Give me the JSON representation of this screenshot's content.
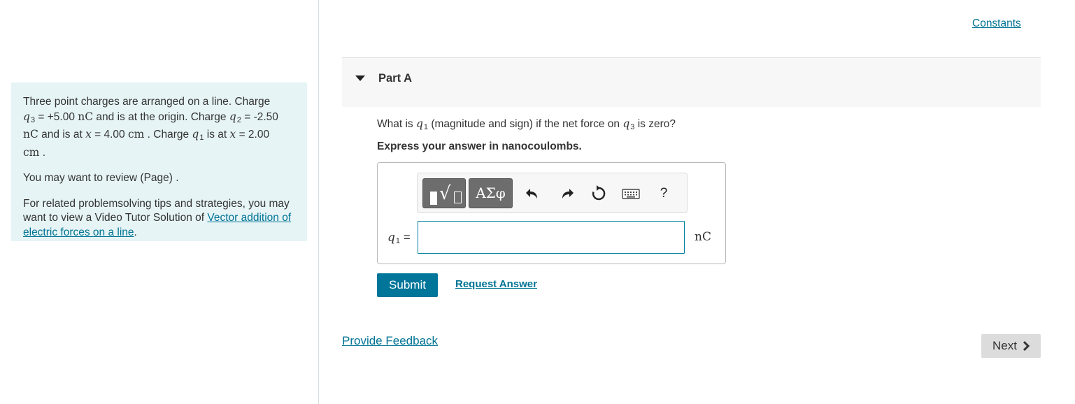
{
  "problem": {
    "intro": "Three point charges are arranged on a line. Charge",
    "q3_symbol": "q",
    "q3_sub": "3",
    "q3_value": " = +5.00 ",
    "q3_unit": "nC",
    "q3_tail": " and is at the origin. Charge ",
    "q2_symbol": "q",
    "q2_sub": "2",
    "q2_value": " = -2.50",
    "q2_unit": "nC",
    "q2_tail": " and is at ",
    "x_symbol": "x",
    "q2_pos": " = 4.00 ",
    "cm_unit": "cm",
    "q1_intro": " . Charge ",
    "q1_symbol": "q",
    "q1_sub": "1",
    "q1_tail": " is at ",
    "q1_pos": " = 2.00",
    "cm_unit2": "cm",
    "end_period": " .",
    "review_text": "You may want to review (Page) .",
    "tips_text": "For related problemsolving tips and strategies, you may want to view a Video Tutor Solution of ",
    "tips_link": "Vector addition of electric forces on a line",
    "tips_end": "."
  },
  "header": {
    "constants_link": "Constants"
  },
  "part": {
    "title": "Part A",
    "question_pre": "What is ",
    "question_q": "q",
    "question_q_sub": "1",
    "question_mid": " (magnitude and sign) if the net force on ",
    "question_q3": "q",
    "question_q3_sub": "3",
    "question_post": " is zero?",
    "instruction": "Express your answer in nanocoulombs."
  },
  "toolbar": {
    "greek_label": "ΑΣφ",
    "help_label": "?"
  },
  "answer": {
    "label_symbol": "q",
    "label_sub": "1",
    "label_eq": " =",
    "input_value": "",
    "unit": "nC"
  },
  "actions": {
    "submit_label": "Submit",
    "request_label": "Request Answer",
    "feedback_label": "Provide Feedback",
    "next_label": "Next"
  }
}
